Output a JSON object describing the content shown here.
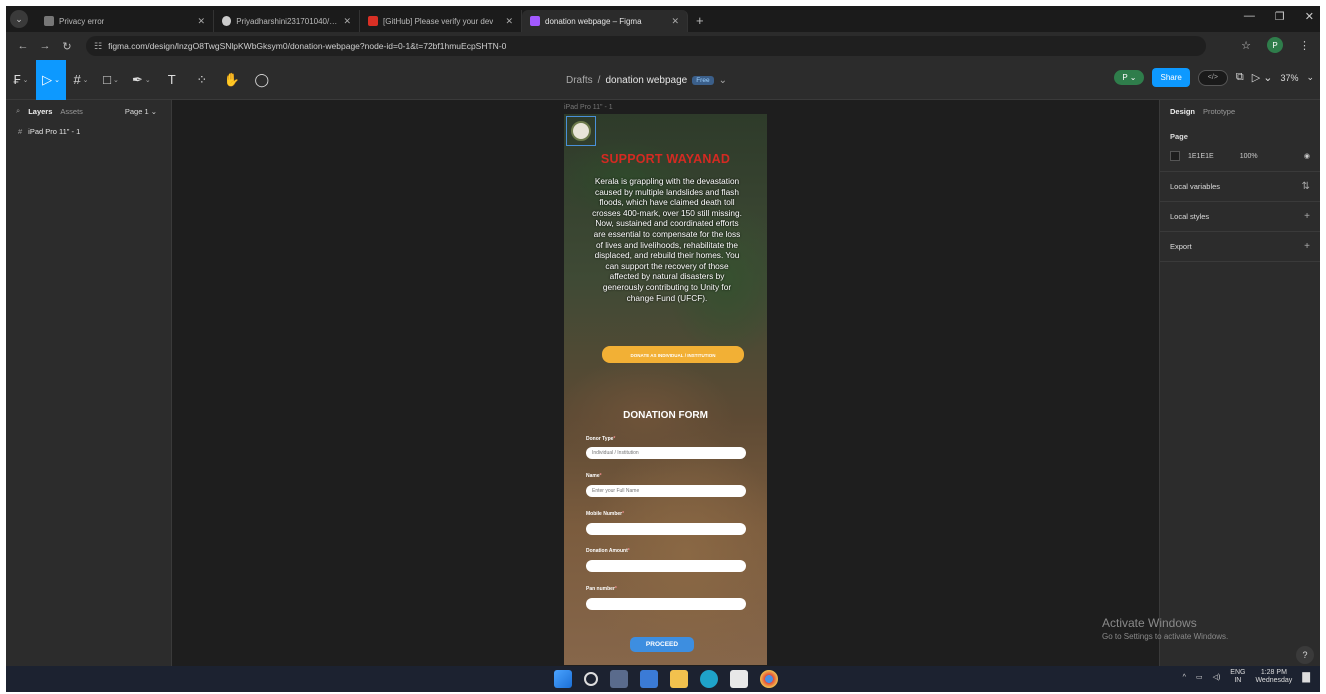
{
  "browser": {
    "tabs": [
      {
        "label": "Privacy error",
        "color": "#777777"
      },
      {
        "label": "Priyadharshini231701040/UI-U",
        "color": "#cccccc"
      },
      {
        "label": "[GitHub] Please verify your dev",
        "color": "#d93025"
      },
      {
        "label": "donation webpage – Figma",
        "color": "#a259ff"
      }
    ],
    "url": "figma.com/design/lnzgO8TwgSNlpKWbGksym0/donation-webpage?node-id=0-1&t=72bf1hmuEcpSHTN-0",
    "profile_initial": "P"
  },
  "toolbar": {
    "breadcrumb": "Drafts",
    "separator": "/",
    "file_name": "donation webpage",
    "plan_badge": "Free",
    "user_initial": "P",
    "share_label": "Share",
    "zoom": "37%"
  },
  "left_panel": {
    "tab_layers": "Layers",
    "tab_assets": "Assets",
    "page_selector": "Page 1",
    "layers": [
      {
        "label": "iPad Pro 11\" - 1"
      }
    ]
  },
  "right_panel": {
    "tab_design": "Design",
    "tab_prototype": "Prototype",
    "page_title": "Page",
    "page_color": "1E1E1E",
    "page_opacity": "100%",
    "local_variables": "Local variables",
    "local_styles": "Local styles",
    "export": "Export"
  },
  "canvas": {
    "frame_label": "iPad Pro 11\" - 1",
    "hero_title": "SUPPORT WAYANAD",
    "hero_text": "Kerala is grappling with the devastation caused by multiple landslides and flash floods, which have claimed death toll crosses 400-mark, over 150 still missing. Now, sustained and coordinated efforts are essential to compensate for the loss of lives and livelihoods, rehabilitate the displaced, and rebuild their homes. You can support the recovery of those affected by natural disasters by generously contributing to Unity for change Fund (UFCF).",
    "donate_button": "DONATE AS INDIVIDUAL / INSTITUTION",
    "form_title": "DONATION FORM",
    "fields": [
      {
        "label": "Donor Type",
        "placeholder": "Individual / Institution"
      },
      {
        "label": "Name",
        "placeholder": "Enter your Full Name"
      },
      {
        "label": "Mobile Number",
        "placeholder": ""
      },
      {
        "label": "Donation Amount",
        "placeholder": ""
      },
      {
        "label": "Pan number",
        "placeholder": ""
      }
    ],
    "required_mark": "*",
    "proceed_button": "PROCEED"
  },
  "watermark": {
    "title": "Activate Windows",
    "subtitle": "Go to Settings to activate Windows."
  },
  "taskbar": {
    "language": "ENG",
    "region": "IN",
    "time": "1:28 PM",
    "day": "Wednesday"
  }
}
